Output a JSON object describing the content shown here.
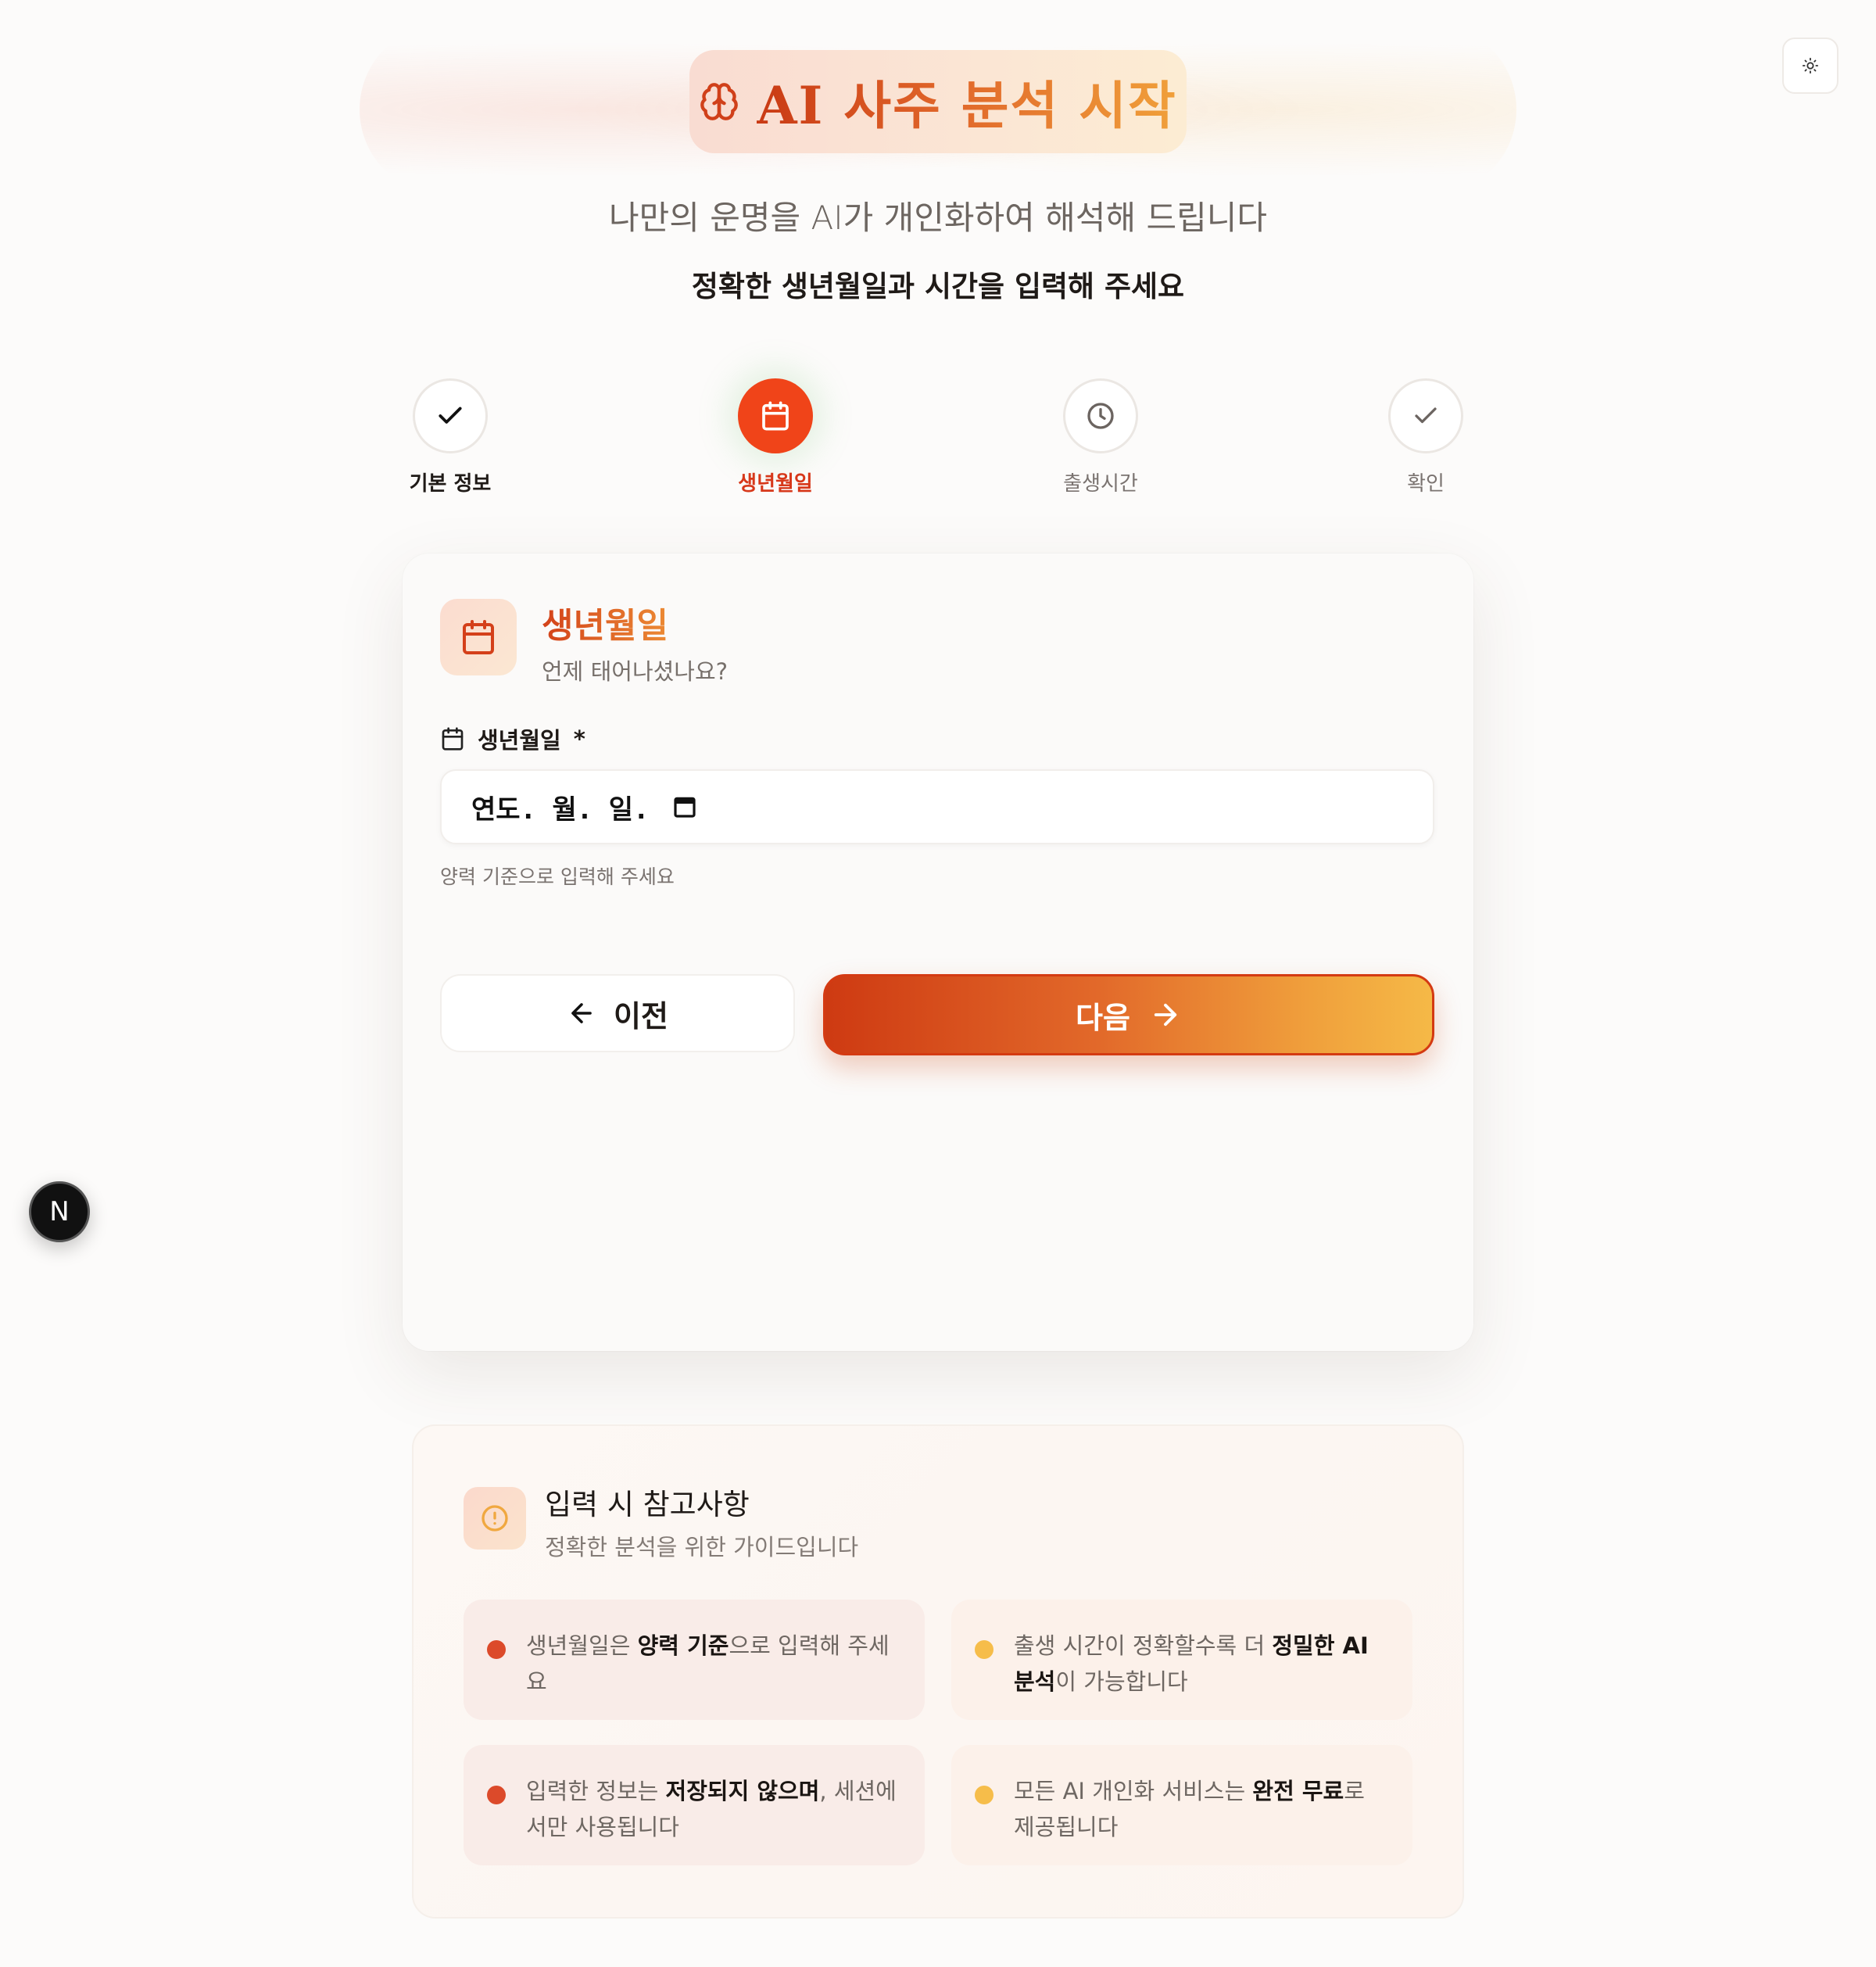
{
  "header": {
    "title": "AI 사주 분석 시작",
    "subtitle": "나만의 운명을 AI가 개인화하여 해석해 드립니다",
    "instruction": "정확한 생년월일과 시간을 입력해 주세요"
  },
  "steps": [
    {
      "label": "기본 정보",
      "state": "done",
      "icon": "check-icon"
    },
    {
      "label": "생년월일",
      "state": "active",
      "icon": "calendar-icon"
    },
    {
      "label": "출생시간",
      "state": "pending",
      "icon": "clock-icon"
    },
    {
      "label": "확인",
      "state": "pending",
      "icon": "check-icon"
    }
  ],
  "card": {
    "title": "생년월일",
    "subtitle": "언제 태어나셨나요?",
    "field_label": "생년월일",
    "required_mark": "*",
    "date_placeholder": "연도. 월. 일.",
    "hint": "양력 기준으로 입력해 주세요",
    "prev_label": "이전",
    "next_label": "다음"
  },
  "guide": {
    "title": "입력 시 참고사항",
    "subtitle": "정확한 분석을 위한 가이드입니다",
    "tips": [
      {
        "pre": "생년월일은 ",
        "bold": "양력 기준",
        "post": "으로 입력해 주세요"
      },
      {
        "pre": "출생 시간이 정확할수록 더 ",
        "bold": "정밀한 AI 분석",
        "post": "이 가능합니다"
      },
      {
        "pre": "입력한 정보는 ",
        "bold": "저장되지 않으며",
        "post": ", 세션에서만 사용됩니다"
      },
      {
        "pre": "모든 AI 개인화 서비스는 ",
        "bold": "완전 무료",
        "post": "로 제공됩니다"
      }
    ]
  },
  "badge": {
    "letter": "N"
  },
  "colors": {
    "primary": "#f04419",
    "accent": "#f5b947"
  }
}
